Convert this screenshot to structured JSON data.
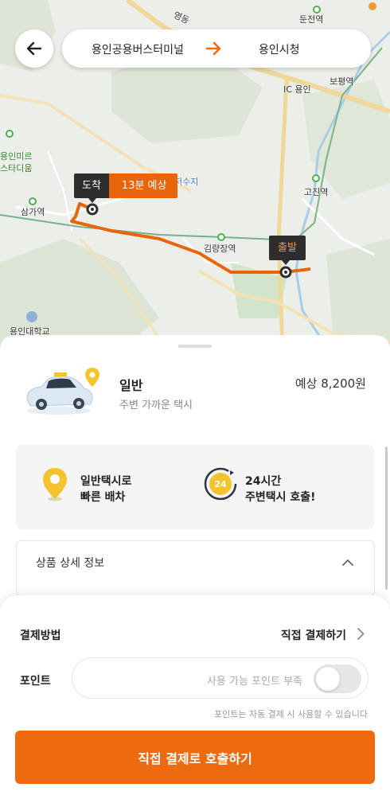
{
  "map": {
    "labels": {
      "road_yeongdong": "영동",
      "dunjeon": "둔전역",
      "ic_yongin": "IC 용인",
      "bopyeong": "보평역",
      "yongin_mireu": "용인미르",
      "stadium": "스타디움",
      "samga": "삼가역",
      "gojin": "고진역",
      "reservoir": "저수지",
      "gimnyangjang": "김량장역",
      "university": "용인대학교"
    },
    "arrive_label": "도착",
    "eta_label": "13분 예상",
    "depart_label": "출발",
    "route_color": "#e8650c"
  },
  "header": {
    "back_icon": "arrow-left-icon",
    "origin": "용인공용버스터미널",
    "destination": "용인시청"
  },
  "taxi": {
    "name": "일반",
    "subtitle": "주변 가까운 택시",
    "price": "예상 8,200원"
  },
  "features": [
    {
      "line1": "일반택시로",
      "line2": "빠른 배차",
      "icon": "location-pin-icon"
    },
    {
      "line1": "24시간",
      "line2": "주변택시 호출!",
      "icon": "24h-clock-icon",
      "icon_text": "24"
    }
  ],
  "details": {
    "title": "상품 상세 정보"
  },
  "payment": {
    "method_label": "결제방법",
    "method_value": "직접 결제하기",
    "point_label": "포인트",
    "point_placeholder": "사용 가능 포인트 부족",
    "point_enabled": false,
    "point_note": "포인트는 자동 결제 시 사용할 수 있습니다"
  },
  "cta": {
    "label": "직접 결제로 호출하기"
  },
  "colors": {
    "accent": "#ed6a0f",
    "dark_tag": "#2d2d2d"
  }
}
